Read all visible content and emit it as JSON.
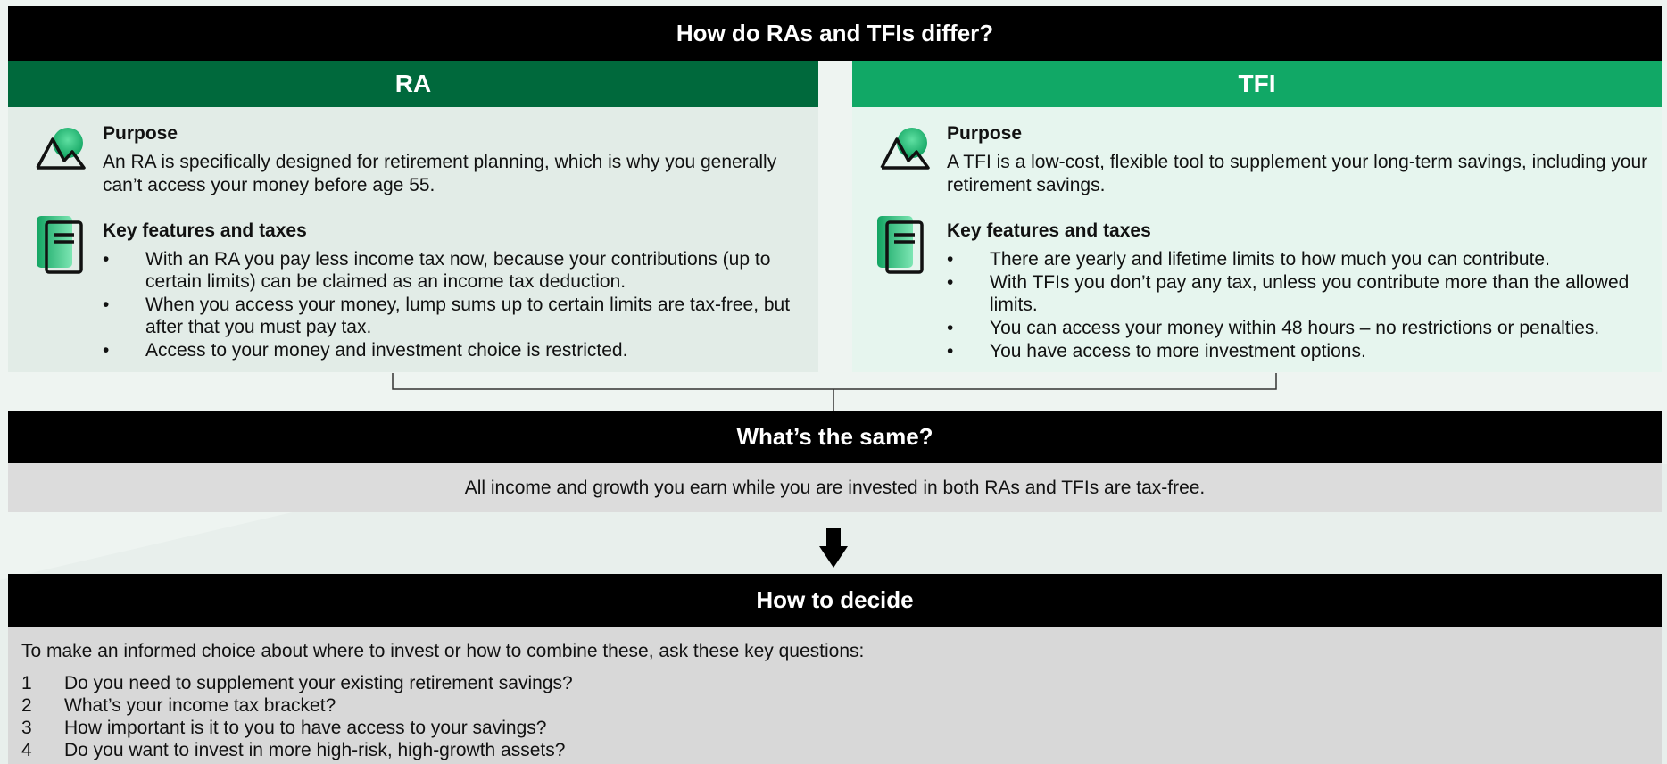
{
  "differ": {
    "title": "How do RAs and TFIs differ?",
    "ra": {
      "title": "RA",
      "purpose_heading": "Purpose",
      "purpose_text": "An RA is specifically designed for retirement planning, which is why you generally can’t access your money before age 55.",
      "features_heading": "Key features and taxes",
      "features": [
        "With an RA you pay less income tax now, because your contributions (up to certain limits) can be claimed as an income tax deduction.",
        "When you access your money, lump sums up to certain limits are tax-free, but after that you must pay tax.",
        "Access to your money and investment choice is restricted."
      ]
    },
    "tfi": {
      "title": "TFI",
      "purpose_heading": "Purpose",
      "purpose_text": "A TFI is a low-cost, flexible tool to supplement your long-term savings, including your retirement savings.",
      "features_heading": "Key features and taxes",
      "features": [
        "There are yearly and lifetime limits to how much you can contribute.",
        "With TFIs you don’t pay any tax, unless you contribute more than the allowed limits.",
        "You can access your money within 48 hours – no restrictions or penalties.",
        "You have access to more investment options."
      ]
    }
  },
  "same": {
    "title": "What’s the same?",
    "text": "All income and growth you earn while you are invested in both RAs and TFIs are tax-free."
  },
  "decide": {
    "title": "How to decide",
    "intro": "To make an informed choice about where to invest or how to combine these, ask these key questions:",
    "questions": [
      {
        "num": "1",
        "text": "Do you need to supplement your existing retirement savings?"
      },
      {
        "num": "2",
        "text": "What’s your income tax bracket?"
      },
      {
        "num": "3",
        "text": "How important is it to you to have access to your savings?"
      },
      {
        "num": "4",
        "text": "Do you want to invest in more high-risk, high-growth assets?"
      }
    ]
  },
  "colors": {
    "ra_header": "#00693c",
    "tfi_header": "#11a866",
    "ra_panel": "#e2ece7",
    "tfi_panel": "#e6f5ee",
    "icon_green": "#1fb36d"
  },
  "icons": {
    "purpose": "mountain-icon",
    "features": "document-icon",
    "arrow": "arrow-down-icon"
  }
}
